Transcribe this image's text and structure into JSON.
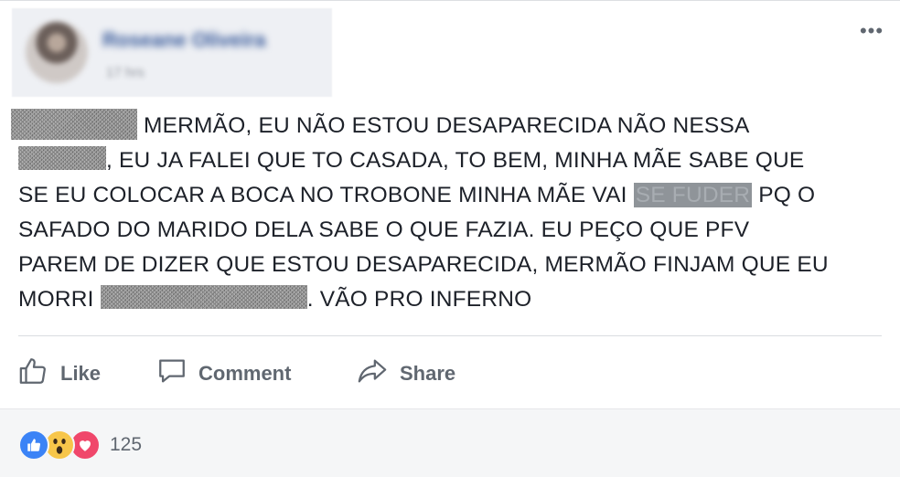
{
  "post": {
    "author": {
      "name": "Roseane Oliveira",
      "time": "17 hrs"
    },
    "more_label": "•••",
    "text": {
      "line1": "MERMÃO, EU NÃO ESTOU DESAPARECIDA NÃO NESSA",
      "line2": ", EU JA FALEI QUE TO CASADA, TO BEM, MINHA MÃE SABE QUE",
      "line3a": "SE EU COLOCAR A BOCA NO TROBONE MINHA MÃE VAI",
      "censored_word": "SE FUDER",
      "line3b": "PQ O",
      "line4": "SAFADO DO MARIDO DELA SABE O QUE FAZIA. EU PEÇO QUE PFV",
      "line5": "PAREM DE DIZER QUE ESTOU DESAPARECIDA, MERMÃO FINJAM QUE EU",
      "line6a": "MORRI",
      "line6b": ". VÃO PRO INFERNO"
    }
  },
  "actions": {
    "like_label": "Like",
    "comment_label": "Comment",
    "share_label": "Share"
  },
  "reactions": {
    "types": [
      "like",
      "wow",
      "love"
    ],
    "count": "125"
  },
  "colors": {
    "accent": "#365899",
    "action_text": "#606770",
    "like": "#3b83f6",
    "love": "#f0476b",
    "wow": "#f7c64a"
  }
}
